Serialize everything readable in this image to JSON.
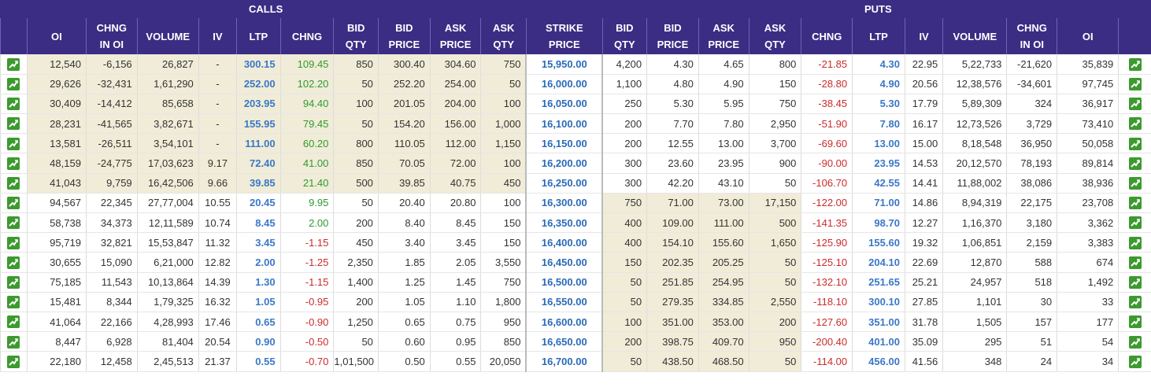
{
  "sections": {
    "calls": "CALLS",
    "puts": "PUTS"
  },
  "headers": {
    "oi": "OI",
    "chng_in_oi_1": "CHNG",
    "chng_in_oi_2": "IN OI",
    "volume": "VOLUME",
    "iv": "IV",
    "ltp": "LTP",
    "chng": "CHNG",
    "bid": "BID",
    "qty": "QTY",
    "price": "PRICE",
    "ask": "ASK",
    "strike_1": "STRIKE",
    "strike_2": "PRICE"
  },
  "icon": "chart-icon",
  "colors": {
    "header": "#3b2d84",
    "itm": "#f0ecd8",
    "ltp": "#3a78c7",
    "positive": "#2f9a2f",
    "negative": "#cc2b2b"
  },
  "rows": [
    {
      "c": [
        "12,540",
        "-6,156",
        "26,827",
        "-",
        "300.15",
        "109.45",
        "850",
        "300.40",
        "304.60",
        "750"
      ],
      "s": "15,950.00",
      "p": [
        "4,200",
        "4.30",
        "4.65",
        "800",
        "-21.85",
        "4.30",
        "22.95",
        "5,22,733",
        "-21,620",
        "35,839"
      ]
    },
    {
      "c": [
        "29,626",
        "-32,431",
        "1,61,290",
        "-",
        "252.00",
        "102.20",
        "50",
        "252.20",
        "254.00",
        "50"
      ],
      "s": "16,000.00",
      "p": [
        "1,100",
        "4.80",
        "4.90",
        "150",
        "-28.80",
        "4.90",
        "20.56",
        "12,38,576",
        "-34,601",
        "97,745"
      ]
    },
    {
      "c": [
        "30,409",
        "-14,412",
        "85,658",
        "-",
        "203.95",
        "94.40",
        "100",
        "201.05",
        "204.00",
        "100"
      ],
      "s": "16,050.00",
      "p": [
        "250",
        "5.30",
        "5.95",
        "750",
        "-38.45",
        "5.30",
        "17.79",
        "5,89,309",
        "324",
        "36,917"
      ]
    },
    {
      "c": [
        "28,231",
        "-41,565",
        "3,82,671",
        "-",
        "155.95",
        "79.45",
        "50",
        "154.20",
        "156.00",
        "1,000"
      ],
      "s": "16,100.00",
      "p": [
        "200",
        "7.70",
        "7.80",
        "2,950",
        "-51.90",
        "7.80",
        "16.17",
        "12,73,526",
        "3,729",
        "73,410"
      ]
    },
    {
      "c": [
        "13,581",
        "-26,511",
        "3,54,101",
        "-",
        "111.00",
        "60.20",
        "800",
        "110.05",
        "112.00",
        "1,150"
      ],
      "s": "16,150.00",
      "p": [
        "200",
        "12.55",
        "13.00",
        "3,700",
        "-69.60",
        "13.00",
        "15.00",
        "8,18,548",
        "36,950",
        "50,058"
      ]
    },
    {
      "c": [
        "48,159",
        "-24,775",
        "17,03,623",
        "9.17",
        "72.40",
        "41.00",
        "850",
        "70.05",
        "72.00",
        "100"
      ],
      "s": "16,200.00",
      "p": [
        "300",
        "23.60",
        "23.95",
        "900",
        "-90.00",
        "23.95",
        "14.53",
        "20,12,570",
        "78,193",
        "89,814"
      ]
    },
    {
      "c": [
        "41,043",
        "9,759",
        "16,42,506",
        "9.66",
        "39.85",
        "21.40",
        "500",
        "39.85",
        "40.75",
        "450"
      ],
      "s": "16,250.00",
      "p": [
        "300",
        "42.20",
        "43.10",
        "50",
        "-106.70",
        "42.55",
        "14.41",
        "11,88,002",
        "38,086",
        "38,936"
      ]
    },
    {
      "c": [
        "94,567",
        "22,345",
        "27,77,004",
        "10.55",
        "20.45",
        "9.95",
        "50",
        "20.40",
        "20.80",
        "100"
      ],
      "s": "16,300.00",
      "p": [
        "750",
        "71.00",
        "73.00",
        "17,150",
        "-122.00",
        "71.00",
        "14.86",
        "8,94,319",
        "22,175",
        "23,708"
      ]
    },
    {
      "c": [
        "58,738",
        "34,373",
        "12,11,589",
        "10.74",
        "8.45",
        "2.00",
        "200",
        "8.40",
        "8.45",
        "150"
      ],
      "s": "16,350.00",
      "p": [
        "400",
        "109.00",
        "111.00",
        "500",
        "-141.35",
        "98.70",
        "12.27",
        "1,16,370",
        "3,180",
        "3,362"
      ]
    },
    {
      "c": [
        "95,719",
        "32,821",
        "15,53,847",
        "11.32",
        "3.45",
        "-1.15",
        "450",
        "3.40",
        "3.45",
        "150"
      ],
      "s": "16,400.00",
      "p": [
        "400",
        "154.10",
        "155.60",
        "1,650",
        "-125.90",
        "155.60",
        "19.32",
        "1,06,851",
        "2,159",
        "3,383"
      ]
    },
    {
      "c": [
        "30,655",
        "15,090",
        "6,21,000",
        "12.82",
        "2.00",
        "-1.25",
        "2,350",
        "1.85",
        "2.05",
        "3,550"
      ],
      "s": "16,450.00",
      "p": [
        "150",
        "202.35",
        "205.25",
        "50",
        "-125.10",
        "204.10",
        "22.69",
        "12,870",
        "588",
        "674"
      ]
    },
    {
      "c": [
        "75,185",
        "11,543",
        "10,13,864",
        "14.39",
        "1.30",
        "-1.15",
        "1,400",
        "1.25",
        "1.45",
        "750"
      ],
      "s": "16,500.00",
      "p": [
        "50",
        "251.85",
        "254.95",
        "50",
        "-132.10",
        "251.65",
        "25.21",
        "24,957",
        "518",
        "1,492"
      ]
    },
    {
      "c": [
        "15,481",
        "8,344",
        "1,79,325",
        "16.32",
        "1.05",
        "-0.95",
        "200",
        "1.05",
        "1.10",
        "1,800"
      ],
      "s": "16,550.00",
      "p": [
        "50",
        "279.35",
        "334.85",
        "2,550",
        "-118.10",
        "300.10",
        "27.85",
        "1,101",
        "30",
        "33"
      ]
    },
    {
      "c": [
        "41,064",
        "22,166",
        "4,28,993",
        "17.46",
        "0.65",
        "-0.90",
        "1,250",
        "0.65",
        "0.75",
        "950"
      ],
      "s": "16,600.00",
      "p": [
        "100",
        "351.00",
        "353.00",
        "200",
        "-127.60",
        "351.00",
        "31.78",
        "1,505",
        "157",
        "177"
      ]
    },
    {
      "c": [
        "8,447",
        "6,928",
        "81,404",
        "20.54",
        "0.90",
        "-0.50",
        "50",
        "0.60",
        "0.95",
        "850"
      ],
      "s": "16,650.00",
      "p": [
        "200",
        "398.75",
        "409.70",
        "950",
        "-200.40",
        "401.00",
        "35.09",
        "295",
        "51",
        "54"
      ]
    },
    {
      "c": [
        "22,180",
        "12,458",
        "2,45,513",
        "21.37",
        "0.55",
        "-0.70",
        "1,01,500",
        "0.50",
        "0.55",
        "20,050"
      ],
      "s": "16,700.00",
      "p": [
        "50",
        "438.50",
        "468.50",
        "50",
        "-114.00",
        "456.00",
        "41.56",
        "348",
        "24",
        "34"
      ]
    }
  ]
}
